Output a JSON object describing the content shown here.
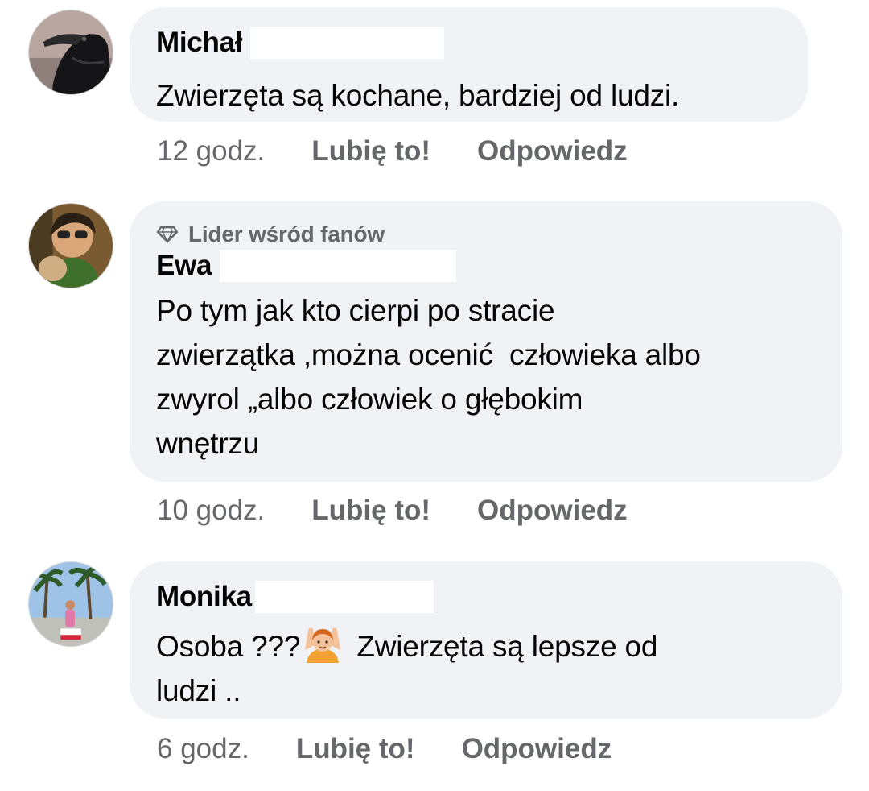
{
  "comments": [
    {
      "author": "Michał",
      "text": "Zwierzęta są kochane, bardziej od ludzi.",
      "time": "12 godz.",
      "like_label": "Lubię to!",
      "reply_label": "Odpowiedz"
    },
    {
      "badge": "Lider wśród fanów",
      "author": "Ewa",
      "text": "Po tym jak kto cierpi po stracie\nzwierzątka ,można ocenić  człowieka albo\nzwyrol „albo człowiek o głębokim\nwnętrzu",
      "time": "10 godz.",
      "like_label": "Lubię to!",
      "reply_label": "Odpowiedz"
    },
    {
      "author": "Monika",
      "text_before_emoji": "Osoba ???",
      "emoji": "person-gesturing-ok-emoji",
      "text_after_emoji": " Zwierzęta są lepsze od\nludzi ..",
      "time": "6 godz.",
      "like_label": "Lubię to!",
      "reply_label": "Odpowiedz"
    }
  ],
  "colors": {
    "bubble": "#f0f2f5",
    "meta_text": "#65676b",
    "body_text": "#050505"
  }
}
